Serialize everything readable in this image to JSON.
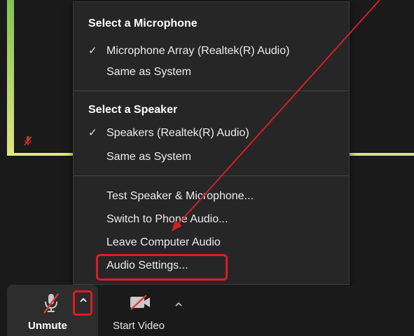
{
  "menu": {
    "microphone_heading": "Select a Microphone",
    "microphone_items": [
      {
        "label": "Microphone Array (Realtek(R) Audio)",
        "checked": true
      },
      {
        "label": "Same as System",
        "checked": false
      }
    ],
    "speaker_heading": "Select a Speaker",
    "speaker_items": [
      {
        "label": "Speakers (Realtek(R) Audio)",
        "checked": true
      },
      {
        "label": "Same as System",
        "checked": false
      }
    ],
    "action_items": [
      {
        "label": "Test Speaker & Microphone..."
      },
      {
        "label": "Switch to Phone Audio..."
      },
      {
        "label": "Leave Computer Audio"
      },
      {
        "label": "Audio Settings..."
      }
    ],
    "check_glyph": "✓"
  },
  "toolbar": {
    "unmute_label": "Unmute",
    "start_video_label": "Start Video",
    "chevron_glyph": "^"
  },
  "icons": {
    "mic": "muted-microphone-icon",
    "video": "video-off-icon",
    "chevron": "chevron-up-icon"
  },
  "colors": {
    "highlight": "#e01b24",
    "menu_bg": "#262626",
    "active_speaker_border": "#a7d85a"
  }
}
